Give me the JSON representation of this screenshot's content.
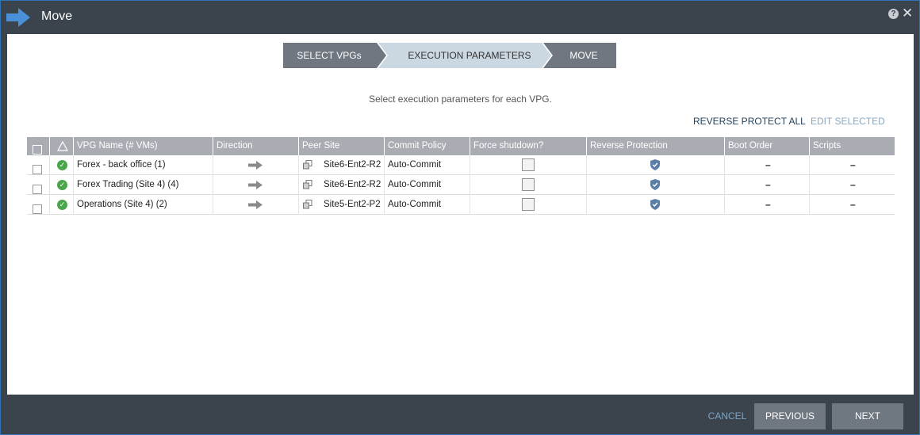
{
  "window": {
    "title": "Move",
    "help_glyph": "?",
    "close_glyph": "✕"
  },
  "wizard": {
    "steps": [
      {
        "label": "SELECT VPGs",
        "state": "done"
      },
      {
        "label": "EXECUTION PARAMETERS",
        "state": "active"
      },
      {
        "label": "MOVE",
        "state": "pending"
      }
    ]
  },
  "instruction": "Select execution parameters for each VPG.",
  "actions": {
    "reverse_protect_all": "REVERSE PROTECT ALL",
    "edit_selected": "EDIT SELECTED"
  },
  "table": {
    "columns": [
      "VPG Name (# VMs)",
      "Direction",
      "Peer Site",
      "Commit Policy",
      "Force shutdown?",
      "Reverse Protection",
      "Boot Order",
      "Scripts"
    ],
    "rows": [
      {
        "name": "Forex - back office (1)",
        "peer_site": "Site6-Ent2-R2",
        "commit_policy": "Auto-Commit",
        "force_shutdown": false,
        "reverse_protection": true,
        "boot_order": "–",
        "scripts": "–"
      },
      {
        "name": "Forex Trading (Site 4) (4)",
        "peer_site": "Site6-Ent2-R2",
        "commit_policy": "Auto-Commit",
        "force_shutdown": false,
        "reverse_protection": true,
        "boot_order": "–",
        "scripts": "–"
      },
      {
        "name": "Operations (Site 4) (2)",
        "peer_site": "Site5-Ent2-P2",
        "commit_policy": "Auto-Commit",
        "force_shutdown": false,
        "reverse_protection": true,
        "boot_order": "–",
        "scripts": "–"
      }
    ]
  },
  "footer": {
    "cancel": "CANCEL",
    "previous": "PREVIOUS",
    "next": "NEXT"
  },
  "icons": {
    "title": "arrow-right-icon",
    "status": "check-circle-icon",
    "direction": "arrow-right-icon",
    "peer_site": "site-icon",
    "reverse_protection": "shield-icon"
  },
  "colors": {
    "accent": "#2f73b8",
    "chrome": "#3b434c",
    "status_ok": "#4aa64a",
    "step_active": "#cbd8e2",
    "step_inactive": "#707780"
  }
}
